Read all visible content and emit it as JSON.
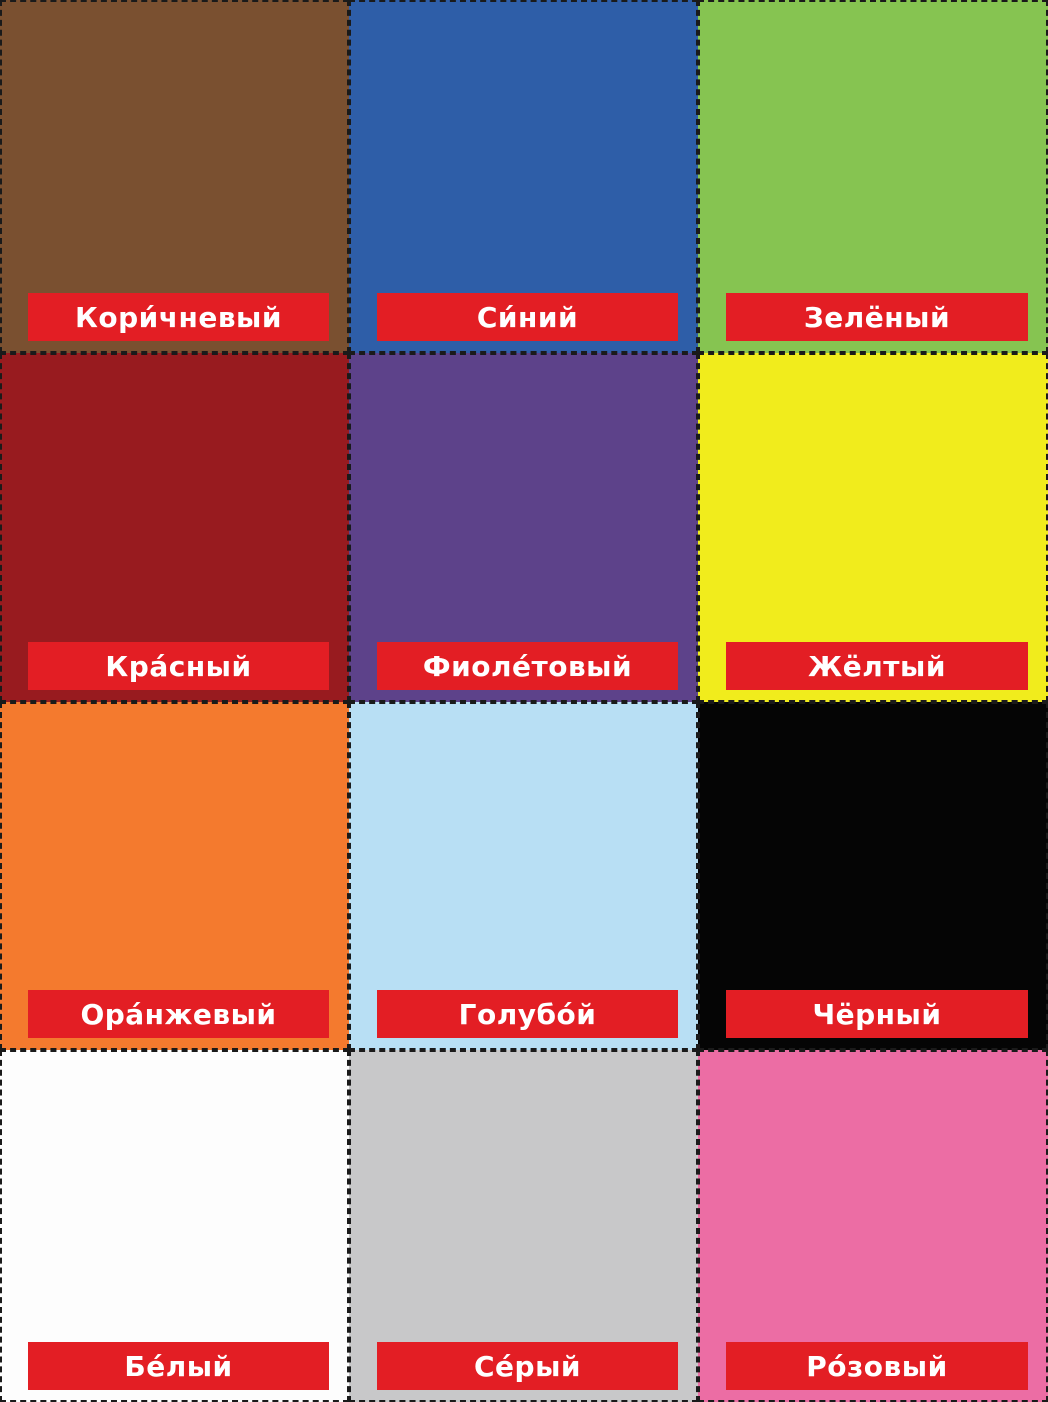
{
  "label_color": "#e31e24",
  "cards": [
    {
      "label": "Кори́чневый",
      "color": "#7a5030"
    },
    {
      "label": "Си́ний",
      "color": "#2e5ea8"
    },
    {
      "label": "Зелёный",
      "color": "#86c451"
    },
    {
      "label": "Кра́сный",
      "color": "#981b1f"
    },
    {
      "label": "Фиоле́товый",
      "color": "#5d428a"
    },
    {
      "label": "Жёлтый",
      "color": "#f1ec1c"
    },
    {
      "label": "Ора́нжевый",
      "color": "#f47a2e"
    },
    {
      "label": "Голубо́й",
      "color": "#b8dff4"
    },
    {
      "label": "Чёрный",
      "color": "#050505"
    },
    {
      "label": "Бе́лый",
      "color": "#fdfdfd"
    },
    {
      "label": "Се́рый",
      "color": "#c8c8c9"
    },
    {
      "label": "Ро́зовый",
      "color": "#ec6da4"
    }
  ]
}
